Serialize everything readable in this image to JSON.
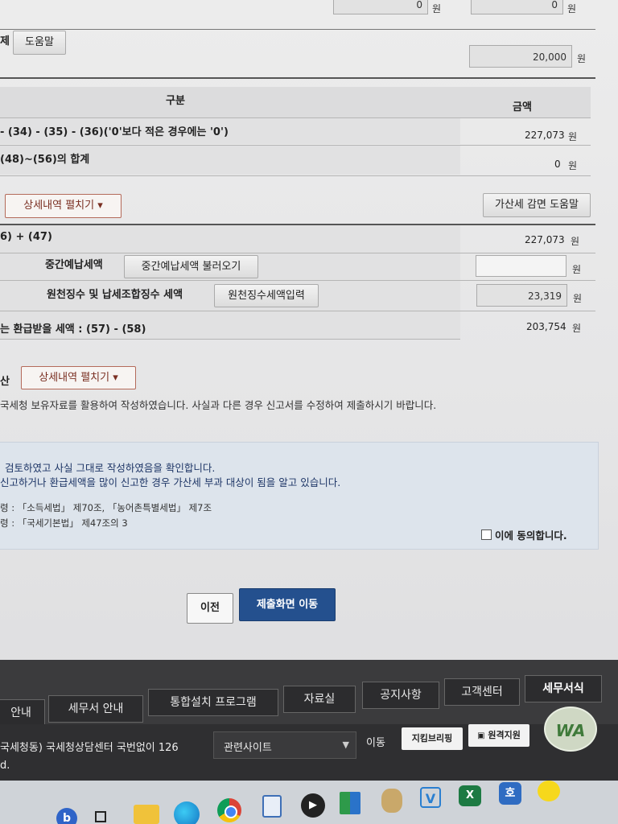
{
  "top_row": {
    "value1": "0",
    "value2": "0",
    "unit": "원"
  },
  "help_row": {
    "label_fragment": "제",
    "help_button": "도움말",
    "amount": "20,000",
    "unit": "원"
  },
  "table1": {
    "header_category": "구분",
    "header_amount": "금액",
    "rows": [
      {
        "label": "- (34) - (35) - (36)('0'보다 적은 경우에는 '0')",
        "amount": "227,073",
        "unit": "원"
      },
      {
        "label": "(48)~(56)의 합계",
        "amount": "0",
        "unit": "원"
      }
    ]
  },
  "detail_toggle_1": "상세내역 펼치기 ▾",
  "penalty_help_button": "가산세 감면 도움말",
  "table2": {
    "row_sum": {
      "label": "6) + (47)",
      "amount": "227,073",
      "unit": "원"
    },
    "interim": {
      "label": "중간예납세액",
      "button": "중간예납세액 불러오기",
      "amount": "",
      "unit": "원"
    },
    "withholding": {
      "label": "원천징수 및 납세조합징수 세액",
      "button": "원천징수세액입력",
      "amount": "23,319",
      "unit": "원"
    },
    "final": {
      "label": "는 환급받을 세액 : (57) - (58)",
      "amount": "203,754",
      "unit": "원"
    }
  },
  "section2": {
    "label_fragment": "산",
    "toggle": "상세내역 펼치기 ▾"
  },
  "notice": "국세청 보유자료를 활용하여 작성하였습니다. 사실과 다른 경우 신고서를 수정하여 제출하시기 바랍니다.",
  "confirm": {
    "line1": "검토하였고 사실 그대로 작성하였음을 확인합니다.",
    "line2": "신고하거나 환급세액을 많이 신고한 경우 가산세 부과 대상이 됨을 알고 있습니다.",
    "law1": "령 : 「소득세법」 제70조, 「농어촌특별세법」 제7조",
    "law2": "령 : 「국세기본법」 제47조의 3",
    "agree": "이에 동의합니다."
  },
  "buttons": {
    "prev": "이전",
    "next": "제출화면 이동"
  },
  "footer": {
    "tabs": [
      "안내",
      "세무서 안내",
      "통합설치 프로그램",
      "자료실",
      "공지사항",
      "고객센터",
      "세무서식"
    ],
    "contact": "국세청동) 국세청상담센터 국번없이 126",
    "contact2": "d.",
    "related_select": "관련사이트",
    "go_button": "이동",
    "badge1": "지킴브리핑",
    "badge2": "원격지원",
    "wa_logo": "WA"
  },
  "taskbar": {
    "icons": [
      "bing-icon",
      "taskview-icon",
      "folder-icon",
      "edge-icon",
      "chrome-icon",
      "notepad-icon",
      "media-icon",
      "app-green-icon",
      "owl-icon",
      "v-icon",
      "excel-icon",
      "hangul-icon",
      "kakao-icon"
    ]
  }
}
